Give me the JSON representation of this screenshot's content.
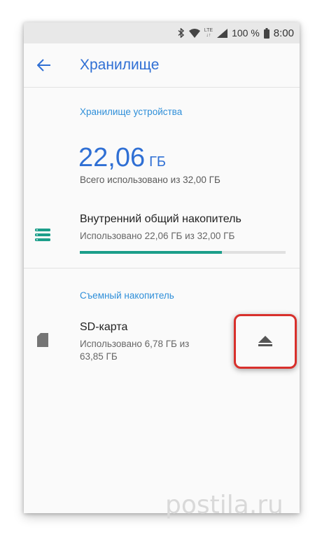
{
  "status_bar": {
    "battery_text": "100 %",
    "time": "8:00",
    "network": "LTE"
  },
  "app_bar": {
    "title": "Хранилище"
  },
  "device_storage": {
    "header": "Хранилище устройства",
    "used_value": "22,06",
    "used_unit": "ГБ",
    "summary": "Всего использовано из 32,00 ГБ"
  },
  "internal_storage": {
    "title": "Внутренний общий накопитель",
    "subtitle": "Использовано 22,06 ГБ из 32,00 ГБ",
    "used_fraction": 0.689,
    "bar_color": "#1b9e8a"
  },
  "removable_storage": {
    "header": "Съемный накопитель",
    "title": "SD-карта",
    "subtitle_line1": "Использовано 6,78 ГБ из",
    "subtitle_line2": "63,85 ГБ"
  },
  "icons": {
    "back": "arrow-left-icon",
    "internal": "storage-list-icon",
    "sd": "sd-card-icon",
    "eject": "eject-icon"
  },
  "colors": {
    "accent": "#2f6fd4",
    "header_accent": "#2f8fd9",
    "highlight": "#d8302c"
  },
  "watermark": "postila.ru"
}
